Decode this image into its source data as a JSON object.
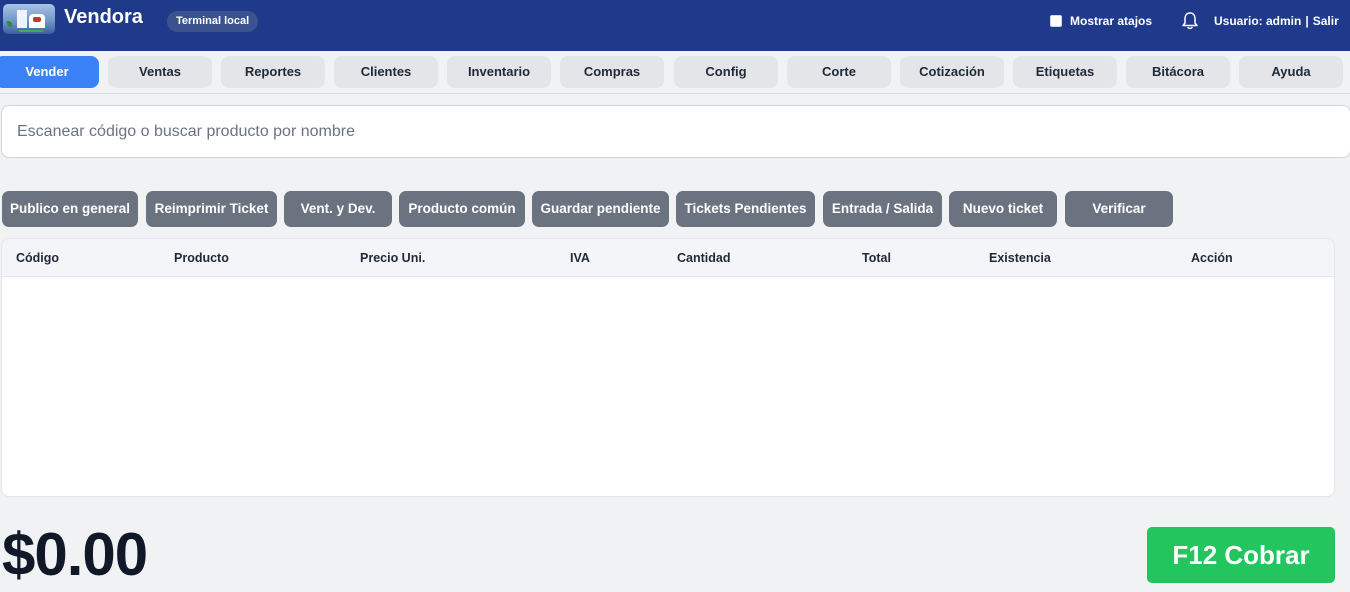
{
  "header": {
    "app_title": "Vendora",
    "terminal_badge": "Terminal local",
    "show_shortcuts_label": "Mostrar atajos",
    "show_shortcuts_checked": false,
    "user_label": "Usuario: admin",
    "separator": "|",
    "logout_label": "Salir",
    "bg_color": "#1f3a8a"
  },
  "nav": {
    "active_index": 0,
    "active_color": "#3b82f6",
    "tabs": [
      {
        "label": "Vender"
      },
      {
        "label": "Ventas"
      },
      {
        "label": "Reportes"
      },
      {
        "label": "Clientes"
      },
      {
        "label": "Inventario"
      },
      {
        "label": "Compras"
      },
      {
        "label": "Config"
      },
      {
        "label": "Corte"
      },
      {
        "label": "Cotización"
      },
      {
        "label": "Etiquetas"
      },
      {
        "label": "Bitácora"
      },
      {
        "label": "Ayuda"
      }
    ]
  },
  "search": {
    "placeholder": "Escanear código o buscar producto por nombre",
    "value": ""
  },
  "actions": {
    "buttons": [
      {
        "label": "Publico en general"
      },
      {
        "label": "Reimprimir Ticket"
      },
      {
        "label": "Vent. y Dev."
      },
      {
        "label": "Producto común"
      },
      {
        "label": "Guardar pendiente"
      },
      {
        "label": "Tickets Pendientes"
      },
      {
        "label": "Entrada / Salida"
      },
      {
        "label": "Nuevo ticket"
      },
      {
        "label": "Verificar"
      }
    ],
    "color": "#6b7280"
  },
  "table": {
    "columns": [
      "Código",
      "Producto",
      "Precio Uni.",
      "IVA",
      "Cantidad",
      "Total",
      "Existencia",
      "Acción"
    ],
    "rows": []
  },
  "footer": {
    "total": "$0.00",
    "charge_label": "F12 Cobrar",
    "charge_color": "#22c55e"
  }
}
